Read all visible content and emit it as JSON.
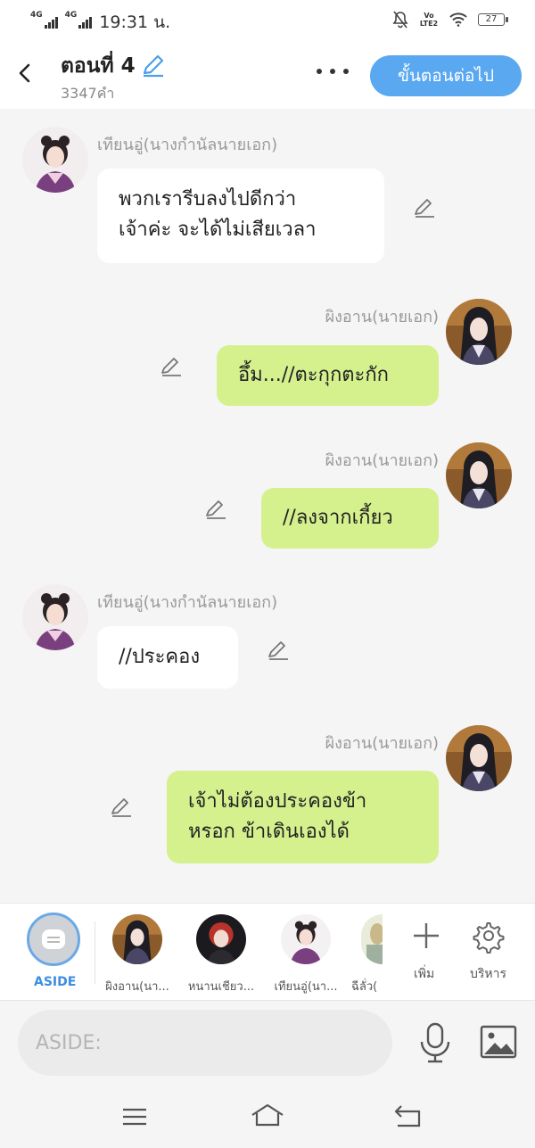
{
  "status_bar": {
    "network1": "4G",
    "network2": "4G",
    "time": "19:31 น.",
    "volte": "Vo LTE2",
    "battery": "27"
  },
  "header": {
    "title": "ตอนที่ 4",
    "word_count": "3347คำ",
    "next_button": "ขั้นตอนต่อไป"
  },
  "messages": [
    {
      "side": "left",
      "name": "เทียนอู่(นางกำนัลนายเอก)",
      "text": "พวกเรารีบลงไปดีกว่า\nเจ้าค่ะ จะได้ไม่เสียเวลา"
    },
    {
      "side": "right",
      "name": "ผิงอาน(นายเอก)",
      "text": "อึ้ม...//ตะกุกตะกัก"
    },
    {
      "side": "right",
      "name": "ผิงอาน(นายเอก)",
      "text": "//ลงจากเกี้ยว"
    },
    {
      "side": "left",
      "name": "เทียนอู่(นางกำนัลนายเอก)",
      "text": "//ประคอง"
    },
    {
      "side": "right",
      "name": "ผิงอาน(นายเอก)",
      "text": "เจ้าไม่ต้องประคองข้า\nหรอก ข้าเดินเองได้"
    }
  ],
  "character_bar": {
    "aside_label": "ASIDE",
    "characters": [
      {
        "label": "ผิงอาน(นา..."
      },
      {
        "label": "หนานเชียว..."
      },
      {
        "label": "เทียนอู่(นา..."
      },
      {
        "label": "ฉีลั่ว("
      }
    ],
    "add_label": "เพิ่ม",
    "manage_label": "บริหาร"
  },
  "input": {
    "placeholder": "ASIDE:"
  },
  "colors": {
    "accent": "#5aa8f0",
    "right_bubble": "#d5f18e",
    "left_bubble": "#ffffff",
    "background": "#f5f5f5"
  }
}
